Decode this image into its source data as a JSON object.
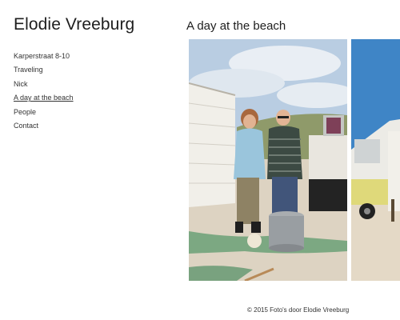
{
  "site": {
    "title": "Elodie Vreeburg"
  },
  "nav": {
    "items": [
      {
        "label": "Karperstraat 8-10"
      },
      {
        "label": "Traveling"
      },
      {
        "label": "Nick"
      },
      {
        "label": "A day at the beach",
        "active": true
      },
      {
        "label": "People"
      },
      {
        "label": "Contact"
      }
    ]
  },
  "main": {
    "heading": "A day at the beach"
  },
  "gallery": {
    "photos": [
      {
        "subject": "couple-at-beach-photo"
      },
      {
        "subject": "beach-caravan-photo"
      }
    ]
  },
  "footer": {
    "text": "© 2015 Foto's door Elodie Vreeburg"
  }
}
